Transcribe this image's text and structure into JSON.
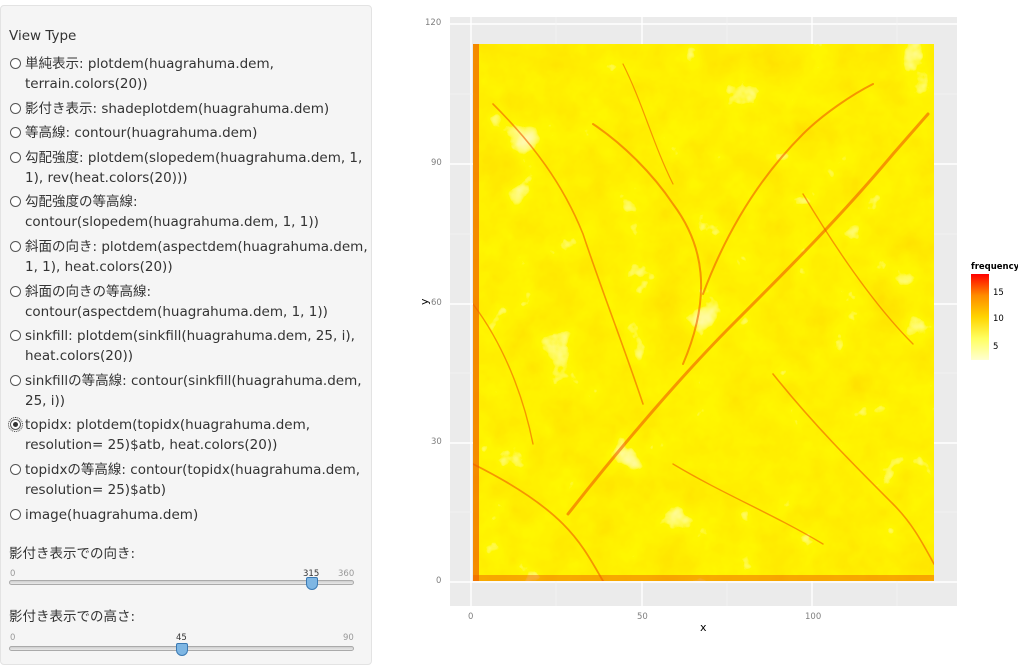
{
  "sidebar": {
    "view_type_label": "View Type",
    "options": [
      {
        "label": "単純表示: plotdem(huagrahuma.dem, terrain.colors(20))",
        "checked": false
      },
      {
        "label": "影付き表示: shadeplotdem(huagrahuma.dem)",
        "checked": false
      },
      {
        "label": "等高線: contour(huagrahuma.dem)",
        "checked": false
      },
      {
        "label": "勾配強度: plotdem(slopedem(huagrahuma.dem, 1, 1), rev(heat.colors(20)))",
        "checked": false
      },
      {
        "label": "勾配強度の等高線: contour(slopedem(huagrahuma.dem, 1, 1))",
        "checked": false
      },
      {
        "label": "斜面の向き: plotdem(aspectdem(huagrahuma.dem, 1, 1), heat.colors(20))",
        "checked": false
      },
      {
        "label": "斜面の向きの等高線: contour(aspectdem(huagrahuma.dem, 1, 1))",
        "checked": false
      },
      {
        "label": "sinkfill: plotdem(sinkfill(huagrahuma.dem, 25, i), heat.colors(20))",
        "checked": false
      },
      {
        "label": "sinkfillの等高線: contour(sinkfill(huagrahuma.dem, 25, i))",
        "checked": false
      },
      {
        "label": "topidx: plotdem(topidx(huagrahuma.dem, resolution= 25)$atb, heat.colors(20))",
        "checked": true
      },
      {
        "label": "topidxの等高線: contour(topidx(huagrahuma.dem, resolution= 25)$atb)",
        "checked": false
      },
      {
        "label": "image(huagrahuma.dem)",
        "checked": false
      }
    ],
    "sliders": [
      {
        "label": "影付き表示での向き:",
        "min": "0",
        "max": "360",
        "value": "315"
      },
      {
        "label": "影付き表示での高さ:",
        "min": "0",
        "max": "90",
        "value": "45"
      }
    ]
  },
  "plot": {
    "xlabel": "x",
    "ylabel": "y",
    "x_ticks": [
      "0",
      "50",
      "100"
    ],
    "y_ticks": [
      "120",
      "90",
      "60",
      "30",
      "0"
    ],
    "legend": {
      "title": "frequency",
      "ticks": [
        "15",
        "10",
        "5"
      ],
      "colors": [
        "#ff0000",
        "#ff8c00",
        "#ffd400",
        "#ffff60",
        "#ffffd0"
      ]
    }
  }
}
